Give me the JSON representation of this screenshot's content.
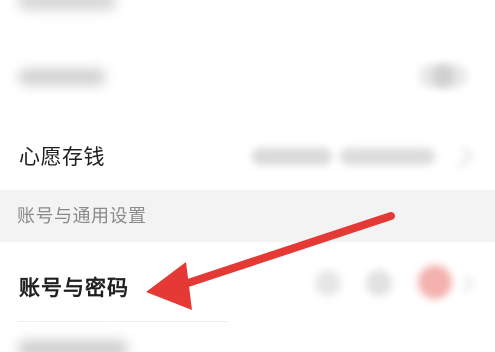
{
  "settings": {
    "wish_saving": {
      "label": "心愿存钱"
    },
    "account_section": {
      "header": "账号与通用设置"
    },
    "account_password": {
      "label": "账号与密码"
    }
  },
  "colors": {
    "accent_arrow": "#e53935",
    "section_background": "#f3f3f3",
    "badge_red": "#f4b1ad"
  }
}
